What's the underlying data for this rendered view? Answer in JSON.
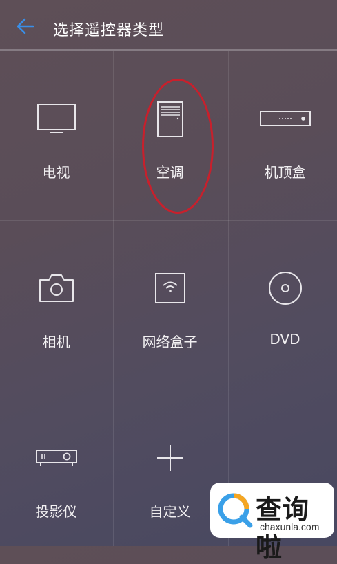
{
  "header": {
    "title": "选择遥控器类型",
    "back_icon": "arrow-left-icon",
    "accent_color": "#3a8ee6"
  },
  "devices": [
    {
      "label": "电视",
      "icon": "tv-icon"
    },
    {
      "label": "空调",
      "icon": "air-conditioner-icon"
    },
    {
      "label": "机顶盒",
      "icon": "set-top-box-icon"
    },
    {
      "label": "相机",
      "icon": "camera-icon"
    },
    {
      "label": "网络盒子",
      "icon": "network-box-icon"
    },
    {
      "label": "DVD",
      "icon": "disc-icon"
    },
    {
      "label": "投影仪",
      "icon": "projector-icon"
    },
    {
      "label": "自定义",
      "icon": "plus-icon"
    }
  ],
  "annotation": {
    "highlight_color": "#c8202c"
  },
  "watermark": {
    "text": "查询啦",
    "url": "chaxunla.com"
  }
}
